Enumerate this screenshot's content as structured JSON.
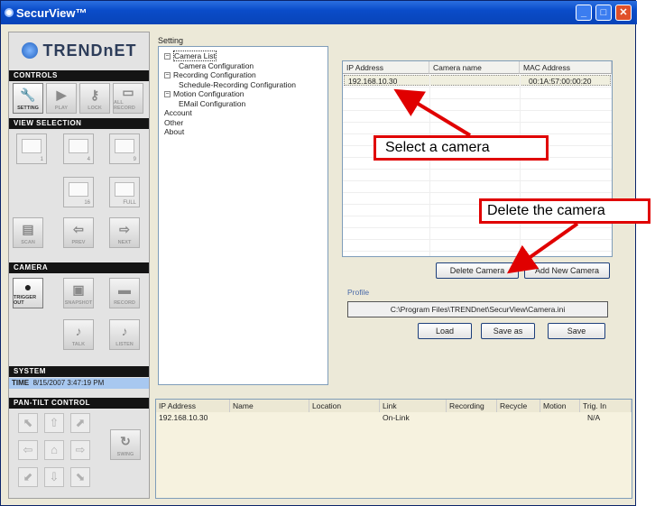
{
  "window": {
    "title": "SecurView™"
  },
  "left": {
    "logo": "TRENDnET",
    "sections": {
      "controls": "CONTROLS",
      "view": "VIEW SELECTION",
      "camera": "CAMERA",
      "system": "SYSTEM",
      "pantilt": "PAN-TILT CONTROL"
    },
    "controls": [
      "SETTING",
      "PLAY",
      "LOCK",
      "ALL RECORD"
    ],
    "views": [
      "1",
      "4",
      "9",
      "16",
      "FULL"
    ],
    "nav": [
      "SCAN",
      "PREV",
      "NEXT"
    ],
    "camera_buttons": [
      "TRIGGER OUT",
      "SNAPSHOT",
      "RECORD",
      "TALK",
      "LISTEN"
    ],
    "time_label": "TIME",
    "time_value": "8/15/2007 3:47:19 PM",
    "swing": "SWING"
  },
  "setting": {
    "label": "Setting",
    "tree": [
      {
        "text": "Camera List",
        "level": 0,
        "expander": "−",
        "selected": true
      },
      {
        "text": "Camera Configuration",
        "level": 1
      },
      {
        "text": "Recording Configuration",
        "level": 0,
        "expander": "−"
      },
      {
        "text": "Schedule-Recording Configuration",
        "level": 1
      },
      {
        "text": "Motion Configuration",
        "level": 0,
        "expander": "−"
      },
      {
        "text": "EMail Configuration",
        "level": 1
      },
      {
        "text": "Account",
        "level": 0
      },
      {
        "text": "Other",
        "level": 0
      },
      {
        "text": "About",
        "level": 0
      }
    ]
  },
  "camera_list": {
    "columns": [
      "IP Address",
      "Camera name",
      "MAC Address"
    ],
    "rows": [
      [
        "192.168.10.30",
        "",
        "00:1A:57:00:00:20"
      ]
    ]
  },
  "buttons": {
    "delete": "Delete Camera",
    "add": "Add New Camera",
    "load": "Load",
    "save_as": "Save as",
    "save": "Save"
  },
  "profile": {
    "label": "Profile",
    "path": "C:\\Program Files\\TRENDnet\\SecurView\\Camera.ini"
  },
  "annotations": {
    "select": "Select a camera",
    "delete": "Delete the camera"
  },
  "status_table": {
    "columns": [
      "IP Address",
      "Name",
      "Location",
      "Link",
      "Recording",
      "Recycle",
      "Motion",
      "Trig. In"
    ],
    "rows": [
      [
        "192.168.10.30",
        "",
        "",
        "On-Link",
        "",
        "",
        "",
        "N/A"
      ]
    ]
  },
  "colors": {
    "annotation": "#e00000",
    "titlebar": "#0a4cc9"
  }
}
